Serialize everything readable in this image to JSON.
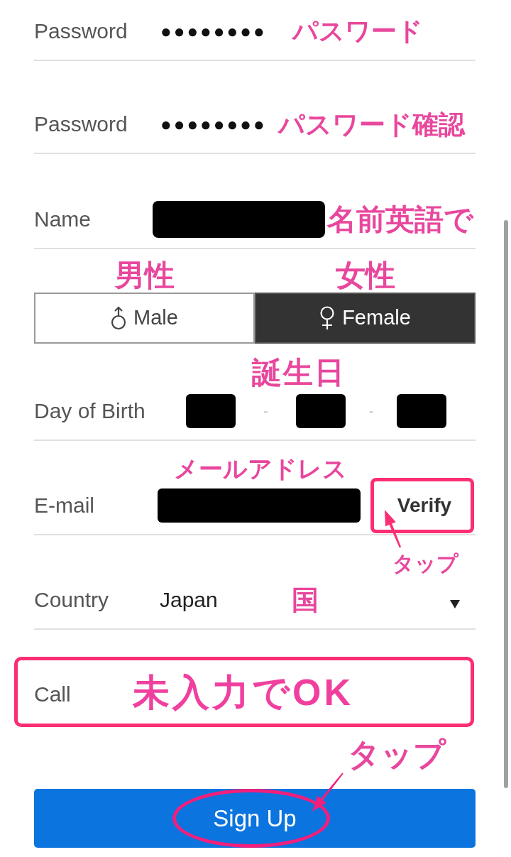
{
  "form": {
    "rows": [
      {
        "kind": "password",
        "label": "Password",
        "value": "●●●●●●●●",
        "note": "パスワード"
      },
      {
        "kind": "password",
        "label": "Password",
        "value": "●●●●●●●●",
        "note": "パスワード確認"
      },
      {
        "kind": "text",
        "label": "Name",
        "redacted": true,
        "note": "名前英語で"
      },
      {
        "kind": "gender",
        "options": [
          {
            "label": "Male",
            "note": "男性",
            "selected": false
          },
          {
            "label": "Female",
            "note": "女性",
            "selected": true
          }
        ]
      },
      {
        "kind": "date",
        "label": "Day of Birth",
        "note": "誕生日",
        "parts": [
          {
            "redacted": true
          },
          {
            "redacted": true
          },
          {
            "redacted": true
          }
        ],
        "separators": [
          "-",
          "-"
        ]
      },
      {
        "kind": "email",
        "label": "E-mail",
        "redacted": true,
        "note": "メールアドレス",
        "button": {
          "label": "Verify",
          "highlighted": true,
          "note": "タップ"
        }
      },
      {
        "kind": "select",
        "label": "Country",
        "value": "Japan",
        "note": "国"
      },
      {
        "kind": "phone",
        "label": "Call",
        "highlighted": true,
        "note": "未入力でOK"
      }
    ]
  },
  "submit": {
    "label": "Sign Up",
    "circled": true,
    "note": "タップ"
  }
}
